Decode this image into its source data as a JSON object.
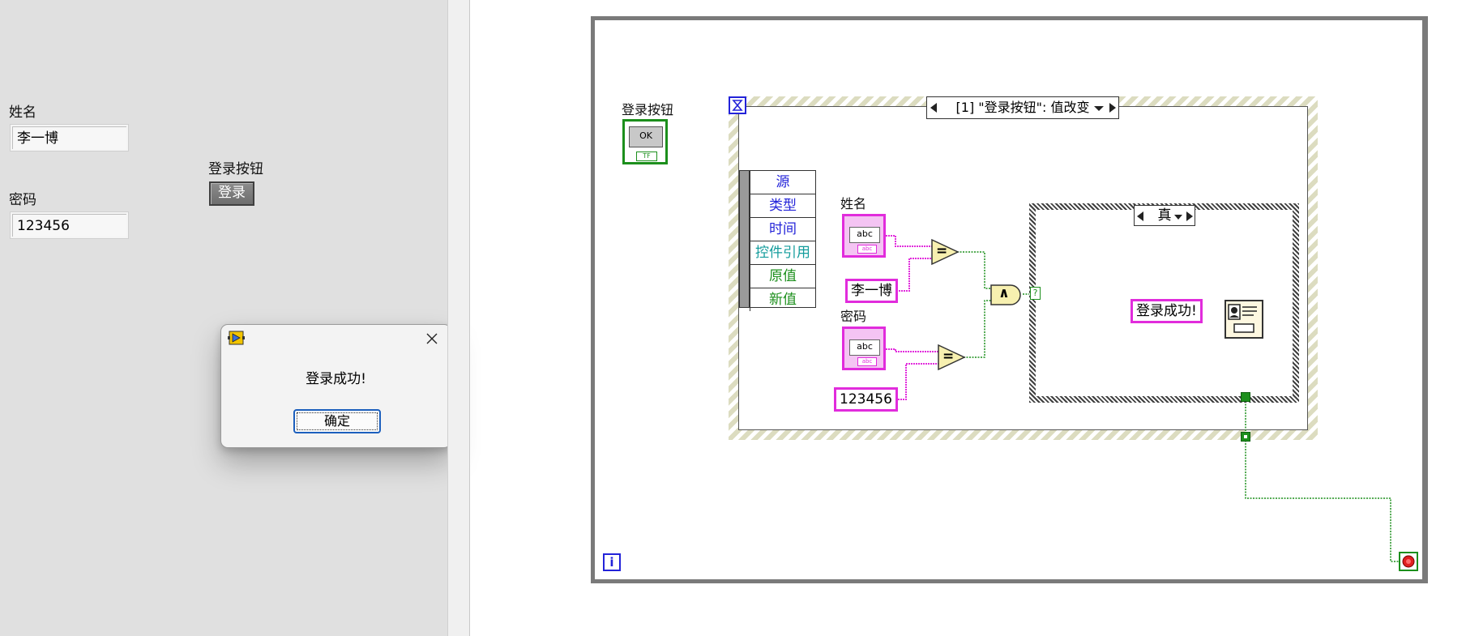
{
  "front_panel": {
    "name_label": "姓名",
    "name_value": "李一博",
    "password_label": "密码",
    "password_value": "123456",
    "button_caption": "登录按钮",
    "button_text": "登录"
  },
  "dialog": {
    "message": "登录成功!",
    "ok_label": "确定"
  },
  "block_diagram": {
    "button_terminal_label": "登录按钮",
    "button_terminal_text": "OK",
    "button_terminal_tag": "TF",
    "event_selector": "[1] \"登录按钮\": 值改变",
    "event_data_node": [
      "源",
      "类型",
      "时间",
      "控件引用",
      "原值",
      "新值"
    ],
    "name_terminal_label": "姓名",
    "password_terminal_label": "密码",
    "name_constant": "李一博",
    "password_constant": "123456",
    "string_terminal_inner": "abc",
    "string_terminal_tag": "abc",
    "case_selector": "真",
    "message_constant": "登录成功!",
    "equal_symbol": "=",
    "and_symbol": "∧",
    "selector_terminal": "?",
    "loop_iteration": "i"
  }
}
